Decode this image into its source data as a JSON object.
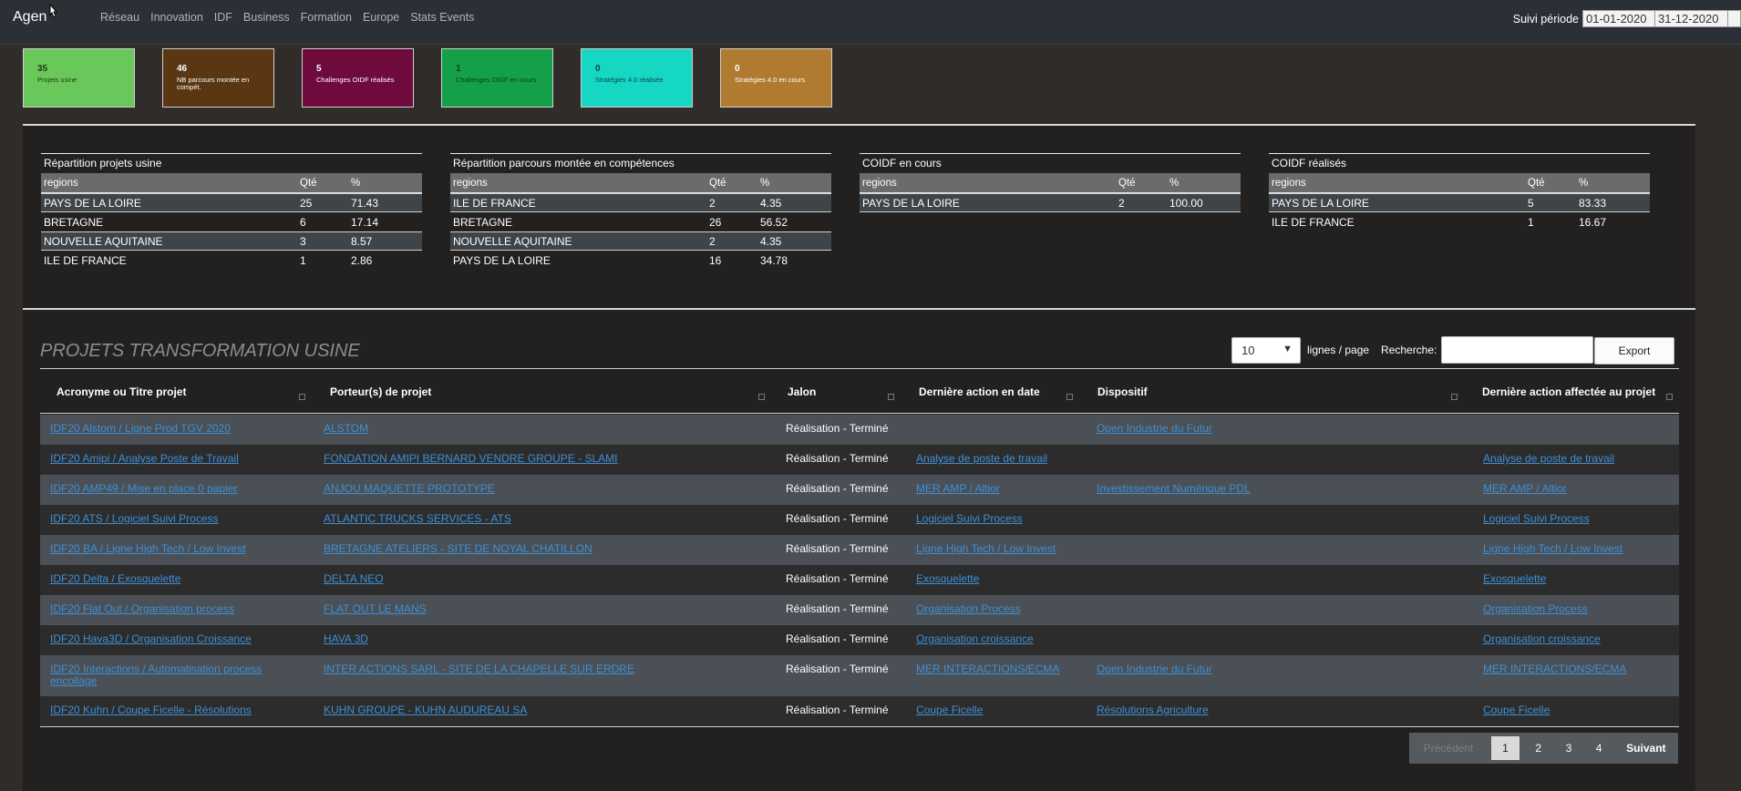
{
  "nav": {
    "brand": "Agen",
    "links": [
      "Réseau",
      "Innovation",
      "IDF",
      "Business",
      "Formation",
      "Europe",
      "Stats Events"
    ],
    "period_label": "Suivi période",
    "date_from": "01-01-2020",
    "date_to": "31-12-2020"
  },
  "kpis": [
    {
      "value": "35",
      "label": "Projets usine",
      "color": "#69c859"
    },
    {
      "value": "46",
      "label": "NB parcours montée en compét.",
      "color": "#5a3712"
    },
    {
      "value": "5",
      "label": "Challenges OIDF réalisés",
      "color": "#6e0a3c"
    },
    {
      "value": "1",
      "label": "Challenges OIDF en cours",
      "color": "#13a048"
    },
    {
      "value": "0",
      "label": "Stratégies 4.0 réalisée",
      "color": "#16d6c4"
    },
    {
      "value": "0",
      "label": "Stratégies 4.0 en cours",
      "color": "#b07b30"
    }
  ],
  "repartitions": [
    {
      "title": "Répartition projets usine",
      "headers": [
        "regions",
        "Qté",
        "%"
      ],
      "rows": [
        [
          "PAYS DE LA LOIRE",
          "25",
          "71.43"
        ],
        [
          "BRETAGNE",
          "6",
          "17.14"
        ],
        [
          "NOUVELLE AQUITAINE",
          "3",
          "8.57"
        ],
        [
          "ILE DE FRANCE",
          "1",
          "2.86"
        ]
      ]
    },
    {
      "title": "Répartition parcours montée en compétences",
      "headers": [
        "regions",
        "Qté",
        "%"
      ],
      "rows": [
        [
          "ILE DE FRANCE",
          "2",
          "4.35"
        ],
        [
          "BRETAGNE",
          "26",
          "56.52"
        ],
        [
          "NOUVELLE AQUITAINE",
          "2",
          "4.35"
        ],
        [
          "PAYS DE LA LOIRE",
          "16",
          "34.78"
        ]
      ]
    },
    {
      "title": "COIDF en cours",
      "headers": [
        "regions",
        "Qté",
        "%"
      ],
      "rows": [
        [
          "PAYS DE LA LOIRE",
          "2",
          "100.00"
        ]
      ]
    },
    {
      "title": "COIDF réalisés",
      "headers": [
        "regions",
        "Qté",
        "%"
      ],
      "rows": [
        [
          "PAYS DE LA LOIRE",
          "5",
          "83.33"
        ],
        [
          "ILE DE FRANCE",
          "1",
          "16.67"
        ]
      ]
    }
  ],
  "projects": {
    "title": "PROJETS TRANSFORMATION USINE",
    "per_page_value": "10",
    "per_page_label": "lignes / page",
    "search_label": "Recherche:",
    "search_value": "",
    "export_label": "Export",
    "columns": [
      "Acronyme ou Titre projet",
      "Porteur(s) de projet",
      "Jalon",
      "Dernière action en date",
      "Dispositif",
      "Dernière action affectée au projet"
    ],
    "rows": [
      [
        "IDF20 Alstom / Ligne Prod TGV 2020",
        "ALSTOM",
        "Réalisation - Terminé",
        "",
        "Open Industrie du Futur",
        ""
      ],
      [
        "IDF20 Amipi / Analyse Poste de Travail",
        "FONDATION AMIPI BERNARD VENDRE GROUPE - SLAMI",
        "Réalisation - Terminé",
        "Analyse de poste de travail",
        "",
        "Analyse de poste de travail"
      ],
      [
        "IDF20 AMP49 / Mise en place 0 papier",
        "ANJOU MAQUETTE PROTOTYPE",
        "Réalisation - Terminé",
        "MER AMP / Altior",
        "Investissement Numérique PDL",
        "MER AMP / Altior"
      ],
      [
        "IDF20 ATS / Logiciel Suivi Process",
        "ATLANTIC TRUCKS SERVICES - ATS",
        "Réalisation - Terminé",
        "Logiciel Suivi Process",
        "",
        "Logiciel Suivi Process"
      ],
      [
        "IDF20 BA / Ligne High Tech / Low Invest",
        "BRETAGNE ATELIERS - SITE DE NOYAL CHATILLON",
        "Réalisation - Terminé",
        "Ligne High Tech / Low Invest",
        "",
        "Ligne High Tech / Low Invest"
      ],
      [
        "IDF20 Delta / Exosquelette",
        "DELTA NEO",
        "Réalisation - Terminé",
        "Exosquelette",
        "",
        "Exosquelette"
      ],
      [
        "IDF20 Flat Out / Organisation process",
        "FLAT OUT LE MANS",
        "Réalisation - Terminé",
        "Organisation Process",
        "",
        "Organisation Process"
      ],
      [
        "IDF20 Hava3D / Organisation Croissance",
        "HAVA 3D",
        "Réalisation - Terminé",
        "Organisation croissance",
        "",
        "Organisation croissance"
      ],
      [
        "IDF20 Interactions / Automatisation process encollage",
        "INTER ACTIONS SARL - SITE DE LA CHAPELLE SUR ERDRE",
        "Réalisation - Terminé",
        "MER INTERACTIONS/ECMA",
        "Open Industrie du Futur",
        "MER INTERACTIONS/ECMA"
      ],
      [
        "IDF20 Kuhn / Coupe Ficelle - Résolutions",
        "KUHN GROUPE - KUHN AUDUREAU SA",
        "Réalisation - Terminé",
        "Coupe Ficelle",
        "Résolutions Agriculture",
        "Coupe Ficelle"
      ]
    ],
    "pagination": {
      "prev": "Précédent",
      "pages": [
        "1",
        "2",
        "3",
        "4"
      ],
      "next": "Suivant"
    }
  }
}
